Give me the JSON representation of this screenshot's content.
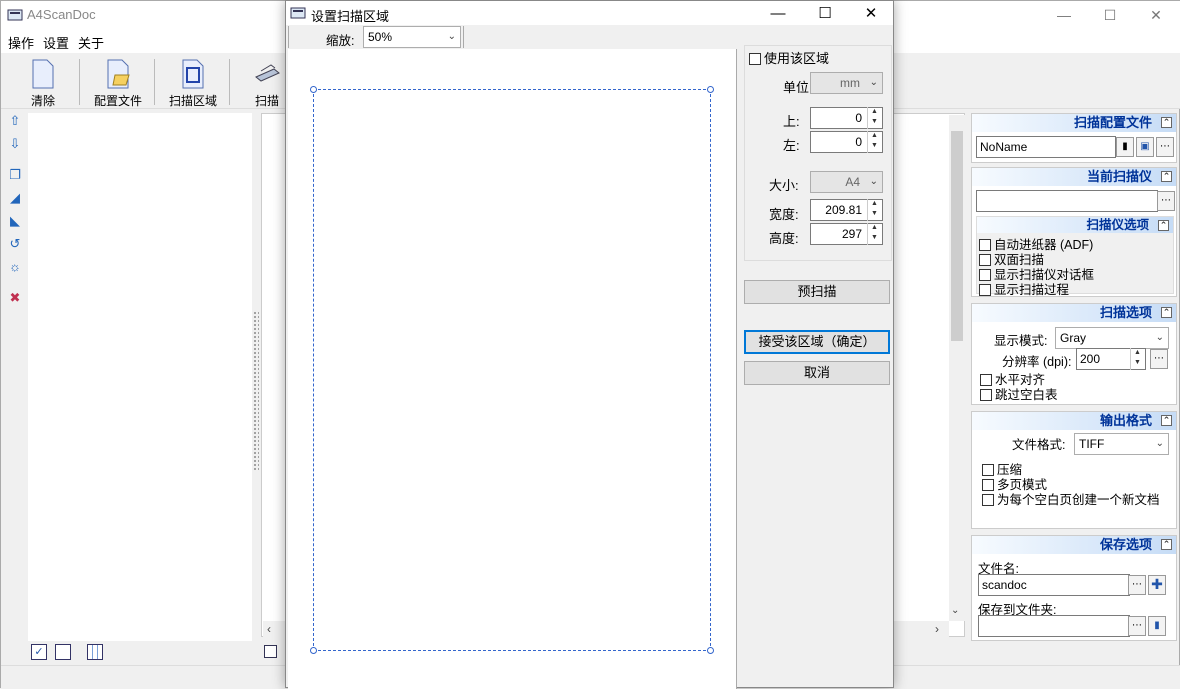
{
  "main": {
    "title": "A4ScanDoc",
    "menu": [
      "操作",
      "设置",
      "关于"
    ],
    "toolbar": {
      "clear": "清除",
      "profile": "配置文件",
      "area": "扫描区域",
      "scan": "扫描"
    },
    "panels": {
      "profile": {
        "header": "扫描配置文件",
        "name": "NoName"
      },
      "scanner": {
        "header": "当前扫描仪",
        "value": ""
      },
      "scanner_options": {
        "header": "扫描仪选项",
        "items": [
          "自动进纸器 (ADF)",
          "双面扫描",
          "显示扫描仪对话框",
          "显示扫描过程"
        ]
      },
      "scan_options": {
        "header": "扫描选项",
        "display_mode_label": "显示模式:",
        "display_mode": "Gray",
        "dpi_label": "分辨率 (dpi):",
        "dpi": "200",
        "items": [
          "水平对齐",
          "跳过空白表"
        ]
      },
      "output": {
        "header": "输出格式",
        "format_label": "文件格式:",
        "format": "TIFF",
        "items": [
          "压缩",
          "多页模式",
          "为每个空白页创建一个新文档"
        ]
      },
      "save": {
        "header": "保存选项",
        "filename_label": "文件名:",
        "filename": "scandoc",
        "folder_label": "保存到文件夹:",
        "folder": ""
      }
    }
  },
  "dialog": {
    "title": "设置扫描区域",
    "zoom_label": "缩放:",
    "zoom": "50%",
    "use_area": "使用该区域",
    "unit_label": "单位",
    "unit": "mm",
    "top_label": "上:",
    "top": "0",
    "left_label": "左:",
    "left": "0",
    "size_label": "大小:",
    "size": "A4",
    "width_label": "宽度:",
    "width": "209.81",
    "height_label": "高度:",
    "height": "297",
    "prescan": "预扫描",
    "accept": "接受该区域（确定）",
    "cancel": "取消"
  }
}
